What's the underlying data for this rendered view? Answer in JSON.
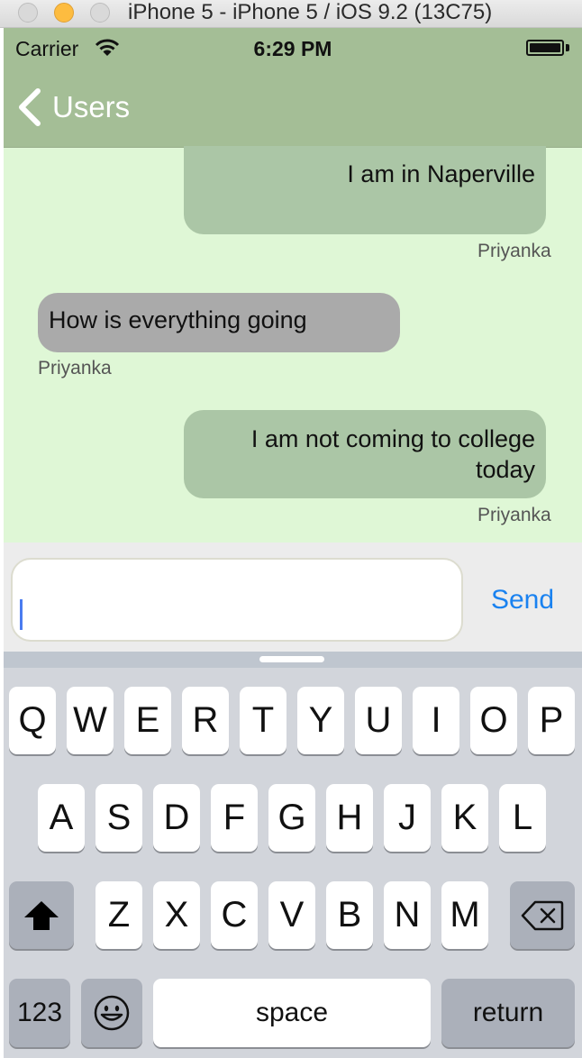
{
  "window": {
    "title": "iPhone 5 - iPhone 5 / iOS 9.2 (13C75)"
  },
  "status_bar": {
    "carrier": "Carrier",
    "time": "6:29 PM"
  },
  "nav": {
    "back_label": "Users"
  },
  "messages": [
    {
      "direction": "outgoing",
      "text": "I am in Naperville",
      "sender": "Priyanka"
    },
    {
      "direction": "incoming",
      "text": "How is everything going",
      "sender": "Priyanka"
    },
    {
      "direction": "outgoing",
      "text": "I am not coming to college today",
      "sender": "Priyanka"
    }
  ],
  "composer": {
    "input_value": "",
    "send_label": "Send"
  },
  "keyboard": {
    "row1": [
      "Q",
      "W",
      "E",
      "R",
      "T",
      "Y",
      "U",
      "I",
      "O",
      "P"
    ],
    "row2": [
      "A",
      "S",
      "D",
      "F",
      "G",
      "H",
      "J",
      "K",
      "L"
    ],
    "row3": [
      "Z",
      "X",
      "C",
      "V",
      "B",
      "N",
      "M"
    ],
    "numbers_label": "123",
    "space_label": "space",
    "return_label": "return",
    "shift_icon": "shift-arrow",
    "delete_icon": "backspace",
    "emoji_icon": "smiley-face"
  },
  "colors": {
    "nav_bar": "#a4be96",
    "chat_background": "#dff7d6",
    "outgoing_bubble": "#abc6a6",
    "incoming_bubble": "#aaaaaa",
    "send_button": "#1a82f0"
  }
}
